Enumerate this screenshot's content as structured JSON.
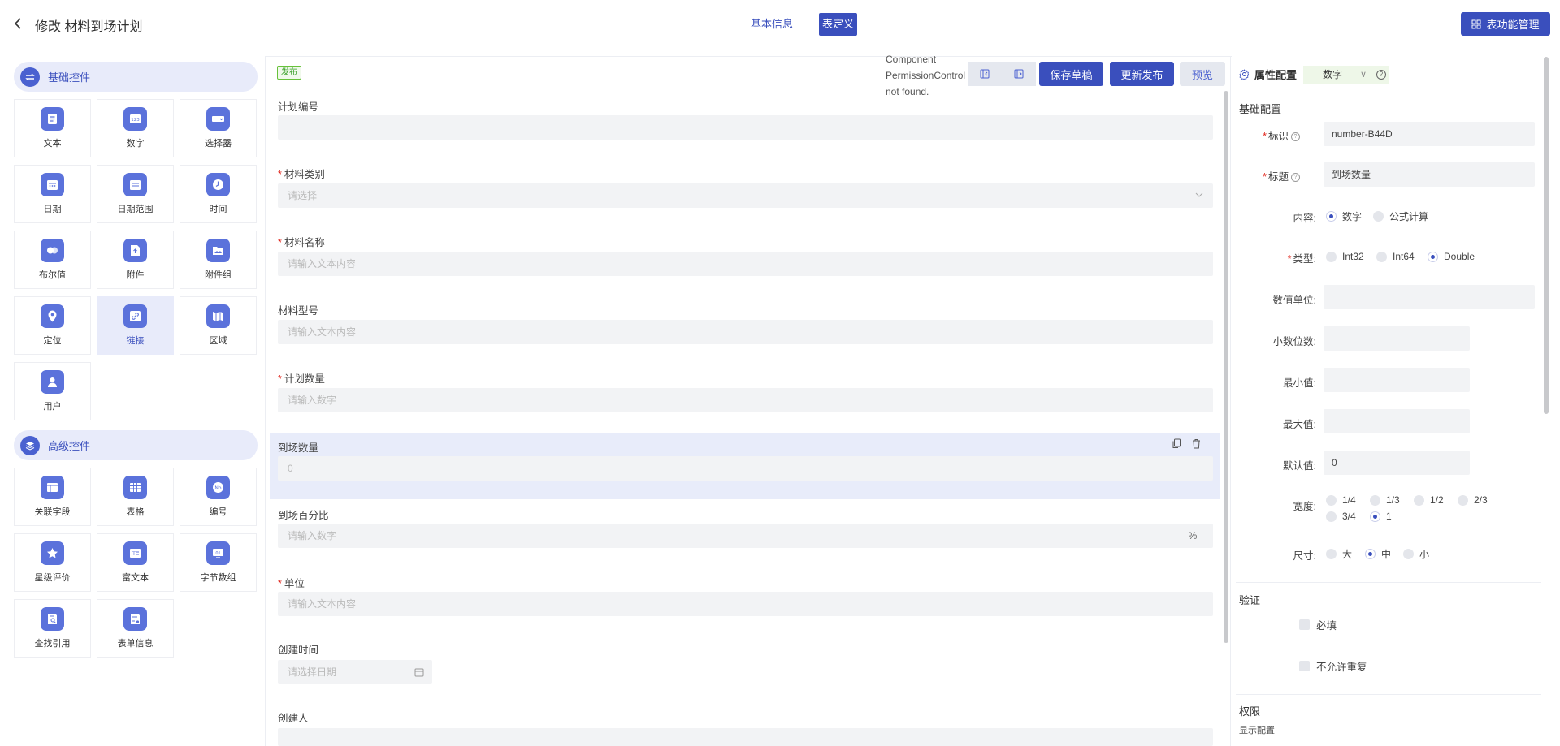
{
  "header": {
    "title": "修改 材料到场计划",
    "tab_basic": "基本信息",
    "tab_form": "表定义",
    "function_button": "表功能管理"
  },
  "palette": {
    "basic_group": "基础控件",
    "basic_items": [
      "文本",
      "数字",
      "选择器",
      "日期",
      "日期范围",
      "时间",
      "布尔值",
      "附件",
      "附件组",
      "定位",
      "链接",
      "区域",
      "用户"
    ],
    "advanced_group": "高级控件",
    "advanced_items": [
      "关联字段",
      "表格",
      "编号",
      "星级评价",
      "富文本",
      "字节数组",
      "查找引用",
      "表单信息"
    ]
  },
  "canvas": {
    "status_badge": "发布",
    "error_text": "Component PermissionControl not found.",
    "save_draft": "保存草稿",
    "publish": "更新发布",
    "preview": "预览",
    "fields": [
      {
        "label": "计划编号",
        "required": false,
        "placeholder": ""
      },
      {
        "label": "材料类别",
        "required": true,
        "placeholder": "请选择"
      },
      {
        "label": "材料名称",
        "required": true,
        "placeholder": "请输入文本内容"
      },
      {
        "label": "材料型号",
        "required": false,
        "placeholder": "请输入文本内容"
      },
      {
        "label": "计划数量",
        "required": true,
        "placeholder": "请输入数字"
      },
      {
        "label": "到场数量",
        "required": false,
        "placeholder": "0"
      },
      {
        "label": "到场百分比",
        "required": false,
        "placeholder": "请输入数字",
        "suffix": "%"
      },
      {
        "label": "单位",
        "required": true,
        "placeholder": "请输入文本内容"
      },
      {
        "label": "创建时间",
        "required": false,
        "placeholder": "请选择日期"
      },
      {
        "label": "创建人",
        "required": false,
        "placeholder": ""
      }
    ]
  },
  "props": {
    "title": "属性配置",
    "type_tag": "数字",
    "section_basic": "基础配置",
    "id_label": "标识",
    "id_value": "number-B44D",
    "title_label": "标题",
    "title_value": "到场数量",
    "content_label": "内容:",
    "content_options": [
      "数字",
      "公式计算"
    ],
    "type_label": "类型:",
    "type_options": [
      "Int32",
      "Int64",
      "Double"
    ],
    "unit_label": "数值单位:",
    "decimal_label": "小数位数:",
    "min_label": "最小值:",
    "max_label": "最大值:",
    "default_label": "默认值:",
    "default_value": "0",
    "width_label": "宽度:",
    "width_options": [
      "1/4",
      "1/3",
      "1/2",
      "2/3",
      "3/4",
      "1"
    ],
    "size_label": "尺寸:",
    "size_options": [
      "大",
      "中",
      "小"
    ],
    "section_validation": "验证",
    "required_check": "必填",
    "unique_check": "不允许重复",
    "section_permission": "权限",
    "display_config": "显示配置"
  }
}
